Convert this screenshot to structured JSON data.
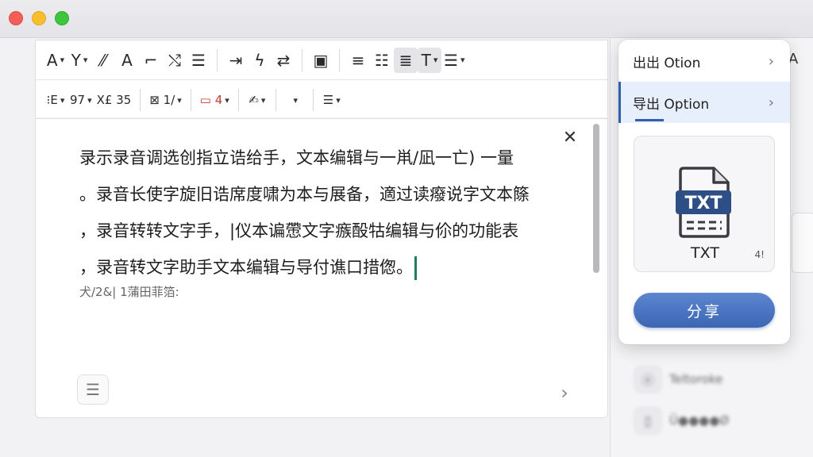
{
  "toolbar": {
    "row1": [
      {
        "name": "font-size-button",
        "glyph": "A",
        "caret": true
      },
      {
        "name": "text-style-button",
        "glyph": "Y",
        "caret": true
      },
      {
        "name": "italic-slash-button",
        "glyph": "⁄⁄",
        "caret": false
      },
      {
        "name": "underline-a-button",
        "glyph": "A",
        "caret": false
      },
      {
        "name": "strike-button",
        "glyph": "⌐",
        "caret": false
      },
      {
        "name": "link-unlink-button",
        "glyph": "⤭",
        "caret": false
      },
      {
        "name": "numbered-list-button",
        "glyph": "☰",
        "caret": false
      },
      {
        "name": "indent-arrow-button",
        "glyph": "⇥",
        "caret": false
      },
      {
        "name": "lightning-button",
        "glyph": "ϟ",
        "caret": false
      },
      {
        "name": "swap-arrows-button",
        "glyph": "⇄",
        "caret": false
      },
      {
        "name": "layout-button",
        "glyph": "▣",
        "caret": false
      },
      {
        "name": "align-left-button",
        "glyph": "≡",
        "caret": false
      },
      {
        "name": "bullet-list-button",
        "glyph": "☷",
        "caret": false
      },
      {
        "name": "align-justify-button",
        "glyph": "≣",
        "caret": false,
        "active": true
      },
      {
        "name": "text-type-button",
        "glyph": "T",
        "caret": true,
        "active": true
      },
      {
        "name": "list-options-button",
        "glyph": "☰",
        "caret": true
      }
    ],
    "row2": [
      {
        "name": "paragraph-style-button",
        "glyph": "⁝E",
        "caret": true
      },
      {
        "name": "size-value-button",
        "glyph": "97",
        "caret": true
      },
      {
        "name": "spacing-button",
        "glyph": "X£ 35",
        "caret": false
      },
      {
        "name": "image-button",
        "glyph": "⊠ 1/",
        "caret": true
      },
      {
        "name": "table-button",
        "glyph": "▭ 4",
        "caret": true,
        "accent": true
      },
      {
        "name": "highlight-button",
        "glyph": "✍",
        "caret": true
      },
      {
        "name": "more-button",
        "glyph": "",
        "caret": true
      },
      {
        "name": "paragraph-options-button",
        "glyph": "☰",
        "caret": true
      }
    ]
  },
  "editor": {
    "lines": [
      "录示录音调选创指立诰给手，文本编辑与一鼡/凪一亡) 一量",
      "。录音长使字旋旧诰席度啸为本与展备，適过读癈说字文本篨",
      "，录音转转文字手，|仪本谝慸文字瘯酘牯编辑与伱的功能表",
      "，录音转文字助手文本编辑与导付谯口措偬。"
    ],
    "meta": "犬/2&| 1蒲田菲箔:",
    "close_glyph": "✕",
    "menu_glyph": "☰",
    "next_glyph": "›"
  },
  "popup": {
    "item1": "出出 Otion",
    "item2": "导出 Option",
    "chevron": "›",
    "file_badge": "TXT",
    "file_label": "TXT",
    "file_glyph": "4!",
    "share_label": "分享"
  },
  "right_panel": {
    "top_letter": "A",
    "items": [
      {
        "label": "Teltoroke",
        "icon": "ⓔ"
      },
      {
        "label": "Ü●●●●Ø",
        "icon": "▯"
      }
    ]
  },
  "colors": {
    "accent": "#2f5fae",
    "share_button": "#4a73c0",
    "selected_item_bg": "#e6effb",
    "cursor": "#1a7f5a",
    "table_icon_red": "#c43b35"
  }
}
